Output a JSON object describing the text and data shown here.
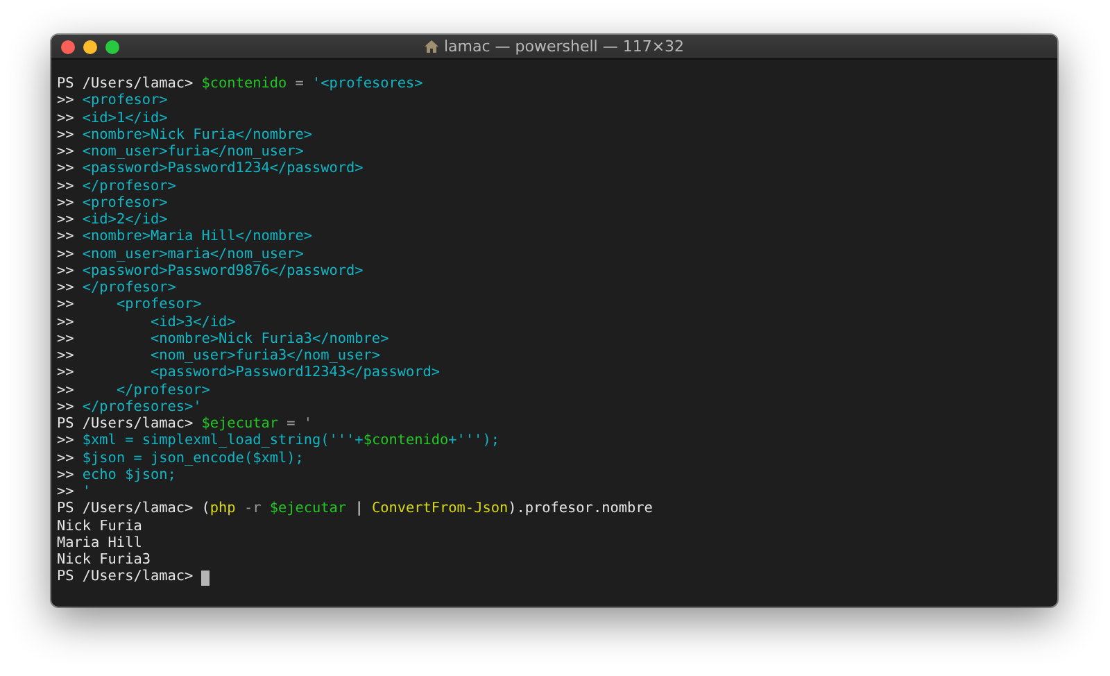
{
  "window": {
    "title": "lamac — powershell — 117×32"
  },
  "lines": [
    {
      "segments": [
        {
          "text": "PS /Users/lamac> ",
          "kind": "plain"
        },
        {
          "text": "$contenido",
          "kind": "var"
        },
        {
          "text": " = ",
          "kind": "op"
        },
        {
          "text": "'<profesores>",
          "kind": "str"
        }
      ]
    },
    {
      "segments": [
        {
          "text": ">> ",
          "kind": "plain"
        },
        {
          "text": "<profesor>",
          "kind": "str"
        }
      ]
    },
    {
      "segments": [
        {
          "text": ">> ",
          "kind": "plain"
        },
        {
          "text": "<id>1</id>",
          "kind": "str"
        }
      ]
    },
    {
      "segments": [
        {
          "text": ">> ",
          "kind": "plain"
        },
        {
          "text": "<nombre>Nick Furia</nombre>",
          "kind": "str"
        }
      ]
    },
    {
      "segments": [
        {
          "text": ">> ",
          "kind": "plain"
        },
        {
          "text": "<nom_user>furia</nom_user>",
          "kind": "str"
        }
      ]
    },
    {
      "segments": [
        {
          "text": ">> ",
          "kind": "plain"
        },
        {
          "text": "<password>Password1234</password>",
          "kind": "str"
        }
      ]
    },
    {
      "segments": [
        {
          "text": ">> ",
          "kind": "plain"
        },
        {
          "text": "</profesor>",
          "kind": "str"
        }
      ]
    },
    {
      "segments": [
        {
          "text": ">> ",
          "kind": "plain"
        },
        {
          "text": "<profesor>",
          "kind": "str"
        }
      ]
    },
    {
      "segments": [
        {
          "text": ">> ",
          "kind": "plain"
        },
        {
          "text": "<id>2</id>",
          "kind": "str"
        }
      ]
    },
    {
      "segments": [
        {
          "text": ">> ",
          "kind": "plain"
        },
        {
          "text": "<nombre>Maria Hill</nombre>",
          "kind": "str"
        }
      ]
    },
    {
      "segments": [
        {
          "text": ">> ",
          "kind": "plain"
        },
        {
          "text": "<nom_user>maria</nom_user>",
          "kind": "str"
        }
      ]
    },
    {
      "segments": [
        {
          "text": ">> ",
          "kind": "plain"
        },
        {
          "text": "<password>Password9876</password>",
          "kind": "str"
        }
      ]
    },
    {
      "segments": [
        {
          "text": ">> ",
          "kind": "plain"
        },
        {
          "text": "</profesor>",
          "kind": "str"
        }
      ]
    },
    {
      "segments": [
        {
          "text": ">>     ",
          "kind": "plain"
        },
        {
          "text": "<profesor>",
          "kind": "str"
        }
      ]
    },
    {
      "segments": [
        {
          "text": ">>         ",
          "kind": "plain"
        },
        {
          "text": "<id>3</id>",
          "kind": "str"
        }
      ]
    },
    {
      "segments": [
        {
          "text": ">>         ",
          "kind": "plain"
        },
        {
          "text": "<nombre>Nick Furia3</nombre>",
          "kind": "str"
        }
      ]
    },
    {
      "segments": [
        {
          "text": ">>         ",
          "kind": "plain"
        },
        {
          "text": "<nom_user>furia3</nom_user>",
          "kind": "str"
        }
      ]
    },
    {
      "segments": [
        {
          "text": ">>         ",
          "kind": "plain"
        },
        {
          "text": "<password>Password12343</password>",
          "kind": "str"
        }
      ]
    },
    {
      "segments": [
        {
          "text": ">>     ",
          "kind": "plain"
        },
        {
          "text": "</profesor>",
          "kind": "str"
        }
      ]
    },
    {
      "segments": [
        {
          "text": ">> ",
          "kind": "plain"
        },
        {
          "text": "</profesores>'",
          "kind": "str"
        }
      ]
    },
    {
      "segments": [
        {
          "text": "PS /Users/lamac> ",
          "kind": "plain"
        },
        {
          "text": "$ejecutar",
          "kind": "var"
        },
        {
          "text": " = '",
          "kind": "op"
        }
      ]
    },
    {
      "segments": [
        {
          "text": ">> ",
          "kind": "plain"
        },
        {
          "text": "$xml = simplexml_load_string('''+",
          "kind": "str"
        },
        {
          "text": "$contenido",
          "kind": "var"
        },
        {
          "text": "+''');",
          "kind": "str"
        }
      ]
    },
    {
      "segments": [
        {
          "text": ">> ",
          "kind": "plain"
        },
        {
          "text": "$json = json_encode($xml);",
          "kind": "str"
        }
      ]
    },
    {
      "segments": [
        {
          "text": ">> ",
          "kind": "plain"
        },
        {
          "text": "echo $json;",
          "kind": "str"
        }
      ]
    },
    {
      "segments": [
        {
          "text": ">> ",
          "kind": "plain"
        },
        {
          "text": "'",
          "kind": "str"
        }
      ]
    },
    {
      "segments": [
        {
          "text": "PS /Users/lamac> (",
          "kind": "plain"
        },
        {
          "text": "php",
          "kind": "cmd"
        },
        {
          "text": " -r ",
          "kind": "op"
        },
        {
          "text": "$ejecutar",
          "kind": "var"
        },
        {
          "text": " | ",
          "kind": "plain"
        },
        {
          "text": "ConvertFrom-Json",
          "kind": "cmd"
        },
        {
          "text": ").profesor.nombre",
          "kind": "plain"
        }
      ]
    },
    {
      "segments": [
        {
          "text": "Nick Furia",
          "kind": "plain"
        }
      ]
    },
    {
      "segments": [
        {
          "text": "Maria Hill",
          "kind": "plain"
        }
      ]
    },
    {
      "segments": [
        {
          "text": "Nick Furia3",
          "kind": "plain"
        }
      ]
    },
    {
      "segments": [
        {
          "text": "PS /Users/lamac> ",
          "kind": "plain"
        }
      ],
      "cursor": true
    }
  ]
}
